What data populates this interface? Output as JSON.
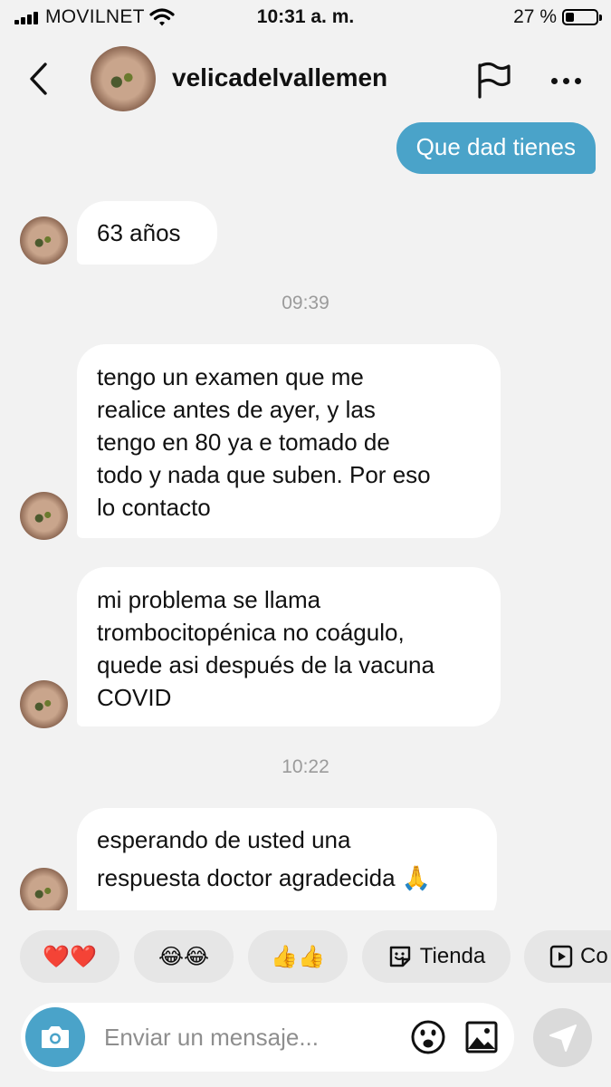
{
  "status_bar": {
    "carrier": "MOVILNET",
    "time": "10:31 a. m.",
    "battery_percent": "27 %",
    "battery_level": 0.27
  },
  "header": {
    "username": "velicadelvallemen",
    "icons": [
      "chevron-left-icon",
      "flag-icon",
      "more-icon"
    ]
  },
  "messages": {
    "outgoing_1": "Que dad tienes",
    "incoming_1": "63 años",
    "time_1": "09:39",
    "incoming_2_lines": [
      "tengo un examen que me",
      "realice antes de ayer, y las",
      "tengo en 80 ya e tomado de",
      "todo y nada que suben. Por eso",
      "lo contacto"
    ],
    "incoming_3_lines": [
      "mi problema se llama",
      "trombocitopénica no coágulo,",
      "quede asi después de la vacuna",
      "COVID"
    ],
    "time_2": "10:22",
    "incoming_4_lines": [
      "esperando de usted una",
      "respuesta doctor agradecida 🙏"
    ]
  },
  "quick_replies": {
    "hearts": "❤️❤️",
    "laugh": "😂😂",
    "thumbs": "👍👍",
    "shop": "Tienda",
    "fifth": "Co"
  },
  "composer": {
    "placeholder": "Enviar un mensaje..."
  },
  "colors": {
    "accent": "#4aa3c9",
    "background": "#f2f2f2",
    "bubble_in": "#ffffff",
    "timestamp": "#9b9b9b"
  }
}
